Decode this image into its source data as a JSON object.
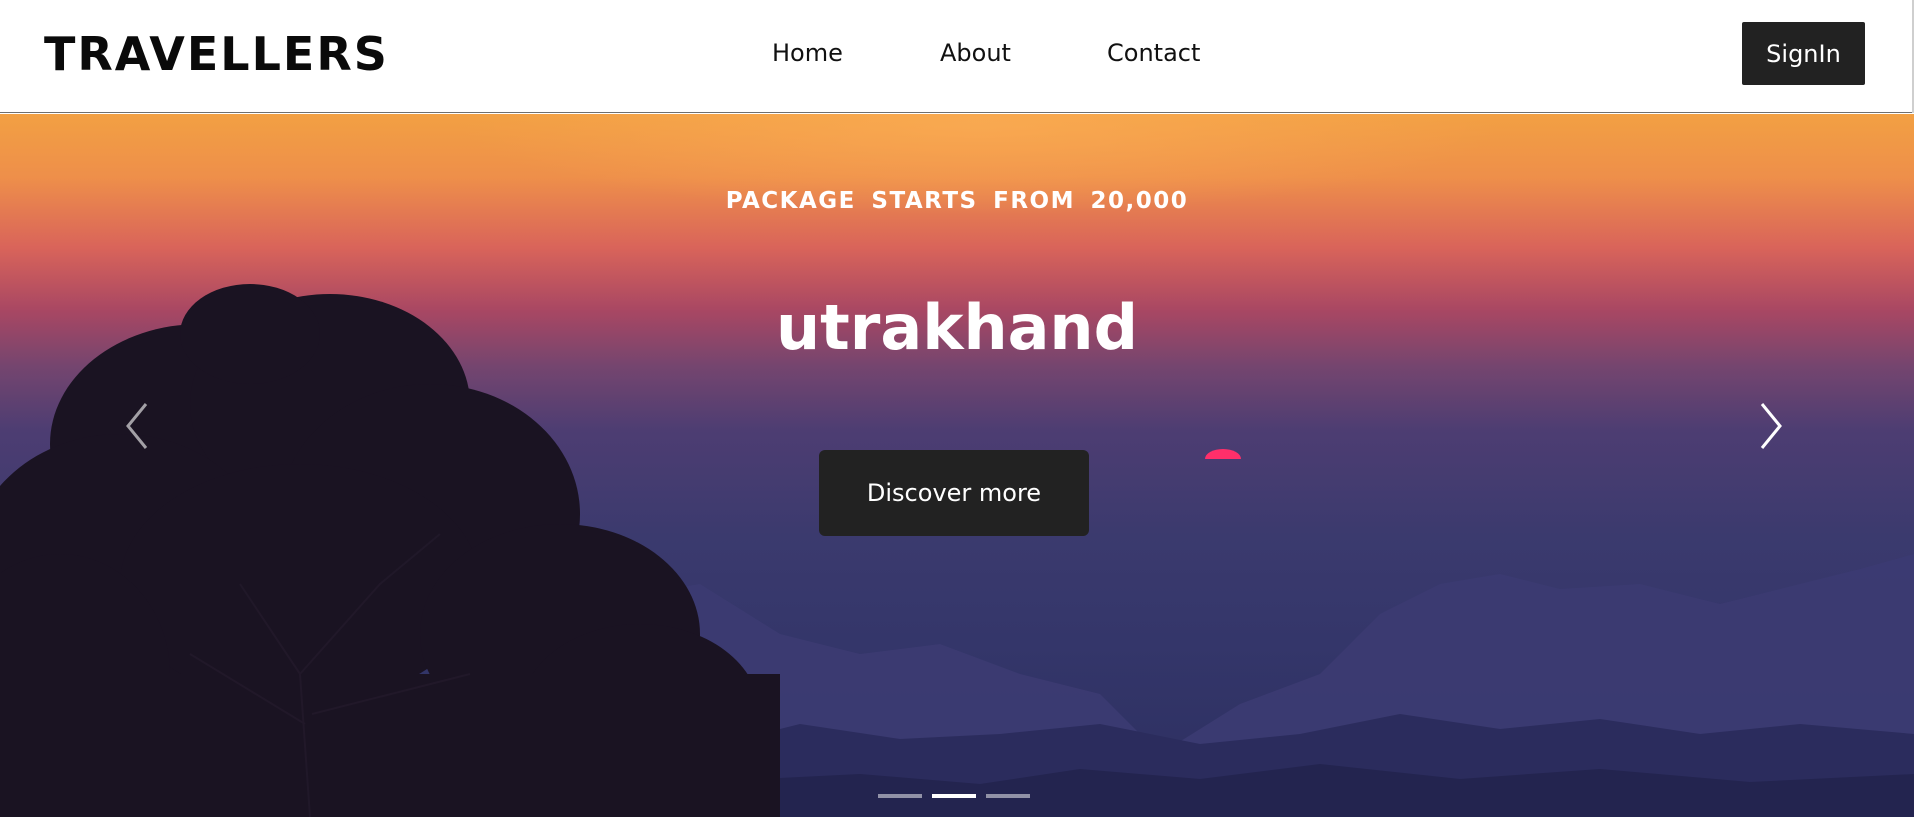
{
  "navbar": {
    "brand": "TRAVELLERS",
    "links": [
      {
        "label": "Home"
      },
      {
        "label": "About"
      },
      {
        "label": "Contact"
      }
    ],
    "signin_label": "SignIn"
  },
  "hero": {
    "subtitle": "PACKAGE STARTS FROM 20,000",
    "title": "utrakhand",
    "cta_label": "Discover more",
    "prev_icon": "chevron-left-icon",
    "next_icon": "chevron-right-icon",
    "slides_total": 3,
    "active_slide": 2
  },
  "colors": {
    "button_bg": "#222222",
    "sky_top": "#f2a043",
    "sky_mid": "#a84763",
    "sky_low": "#34366a"
  }
}
